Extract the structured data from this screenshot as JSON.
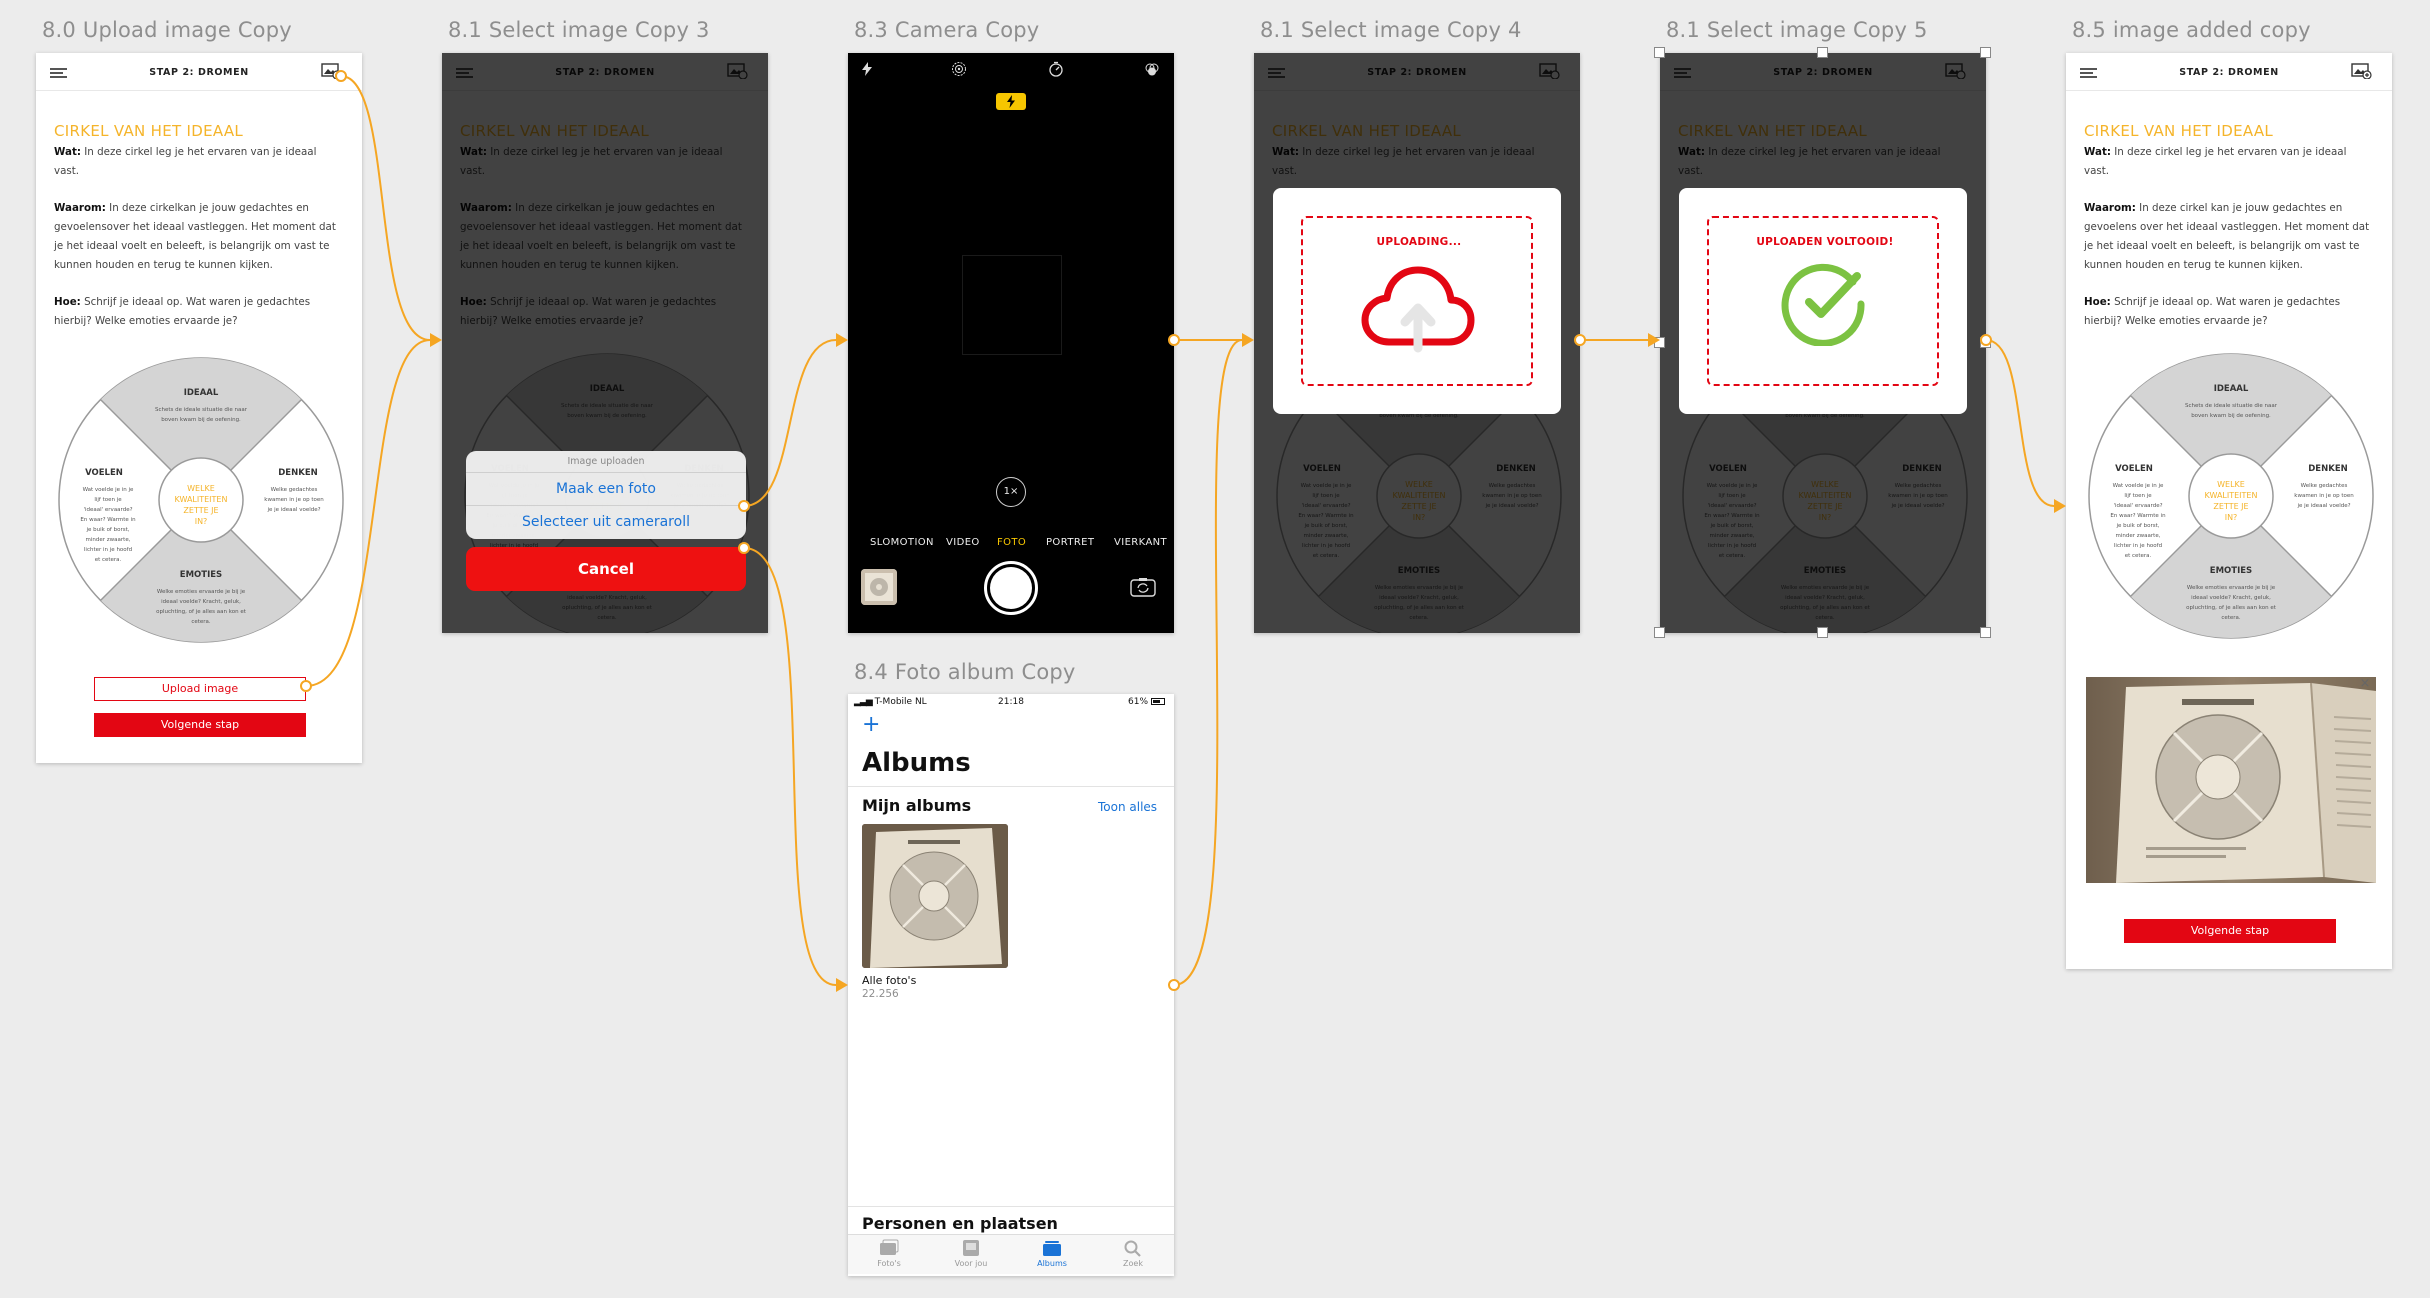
{
  "artboards": {
    "a1": {
      "label": "8.0 Upload image Copy"
    },
    "a2": {
      "label": "8.1 Select image Copy 3"
    },
    "a3": {
      "label": "8.3 Camera Copy"
    },
    "a4": {
      "label": "8.1 Select image Copy 4"
    },
    "a5": {
      "label": "8.1 Select image Copy 5"
    },
    "a6": {
      "label": "8.5 image added copy"
    },
    "a7": {
      "label": "8.4 Foto album Copy"
    }
  },
  "screen": {
    "header_title": "STAP 2: DROMEN",
    "heading": "CIRKEL VAN HET IDEAAL",
    "wat_label": "Wat:",
    "wat_text": " In deze cirkel leg je het ervaren van je ideaal vast.",
    "waarom_label": "Waarom:",
    "waarom_text_a": " In deze cirkelkan je jouw gedachtes en gevoelensover het ideaal vastleggen. Het moment dat je het ideaal voelt en beleeft, is belangrijk om vast te kunnen houden en terug te kunnen kijken.",
    "waarom_text_b": " In deze cirkel kan je jouw gedachtes en gevoelens over het ideaal vastleggen. Het moment dat je het ideaal voelt en beleeft, is belangrijk om vast te kunnen houden en terug te kunnen kijken.",
    "hoe_label": "Hoe:",
    "hoe_text": " Schrijf je ideaal op. Wat waren je gedachtes hierbij? Welke emoties ervaarde je?",
    "upload_btn": "Upload image",
    "next_btn": "Volgende stap"
  },
  "circle": {
    "top": {
      "title": "IDEAAL",
      "text": "Schets de ideale situatie die naar boven kwam bij de oefening."
    },
    "left": {
      "title": "VOELEN",
      "text": "Wat voelde je in je lijf toen je 'ideaal' ervaarde? En waar? Warmte in je buik of borst, minder zwaarte, lichter in je hoofd et cetera."
    },
    "right": {
      "title": "DENKEN",
      "text": "Welke gedachtes kwamen in je op toen je je ideaal voelde?"
    },
    "bottom": {
      "title": "EMOTIES",
      "text": "Welke emoties ervaarde je bij je ideaal voelde? Kracht, geluk, opluchting, of je alles aan kon et cetera."
    },
    "center": "WELKE KWALITEITEN ZETTE JE IN?"
  },
  "sheet": {
    "title": "Image uploaden",
    "option_photo": "Maak een foto",
    "option_roll": "Selecteer uit cameraroll",
    "cancel": "Cancel"
  },
  "camera": {
    "zoom": "1×",
    "modes": [
      "SLOMOTION",
      "VIDEO",
      "FOTO",
      "PORTRET",
      "VIERKANT"
    ],
    "active_mode": "FOTO"
  },
  "uploading": {
    "label": "UPLOADING..."
  },
  "uploaded": {
    "label": "UPLOADEN VOLTOOID!"
  },
  "album": {
    "carrier": "T-Mobile NL",
    "time": "21:18",
    "battery": "61%",
    "plus": "+",
    "title": "Albums",
    "section": "Mijn albums",
    "see_all": "Toon alles",
    "album_name": "Alle foto's",
    "album_count": "22.256",
    "section2": "Personen en plaatsen",
    "tabs": [
      "Foto's",
      "Voor jou",
      "Albums",
      "Zoek"
    ],
    "active_tab": "Albums"
  },
  "added": {
    "close": "×"
  },
  "colors": {
    "accent": "#f5b42a",
    "brand_red": "#e30613",
    "flow": "#f5a623",
    "ios_blue": "#1a73d6",
    "success": "#7cc242"
  }
}
